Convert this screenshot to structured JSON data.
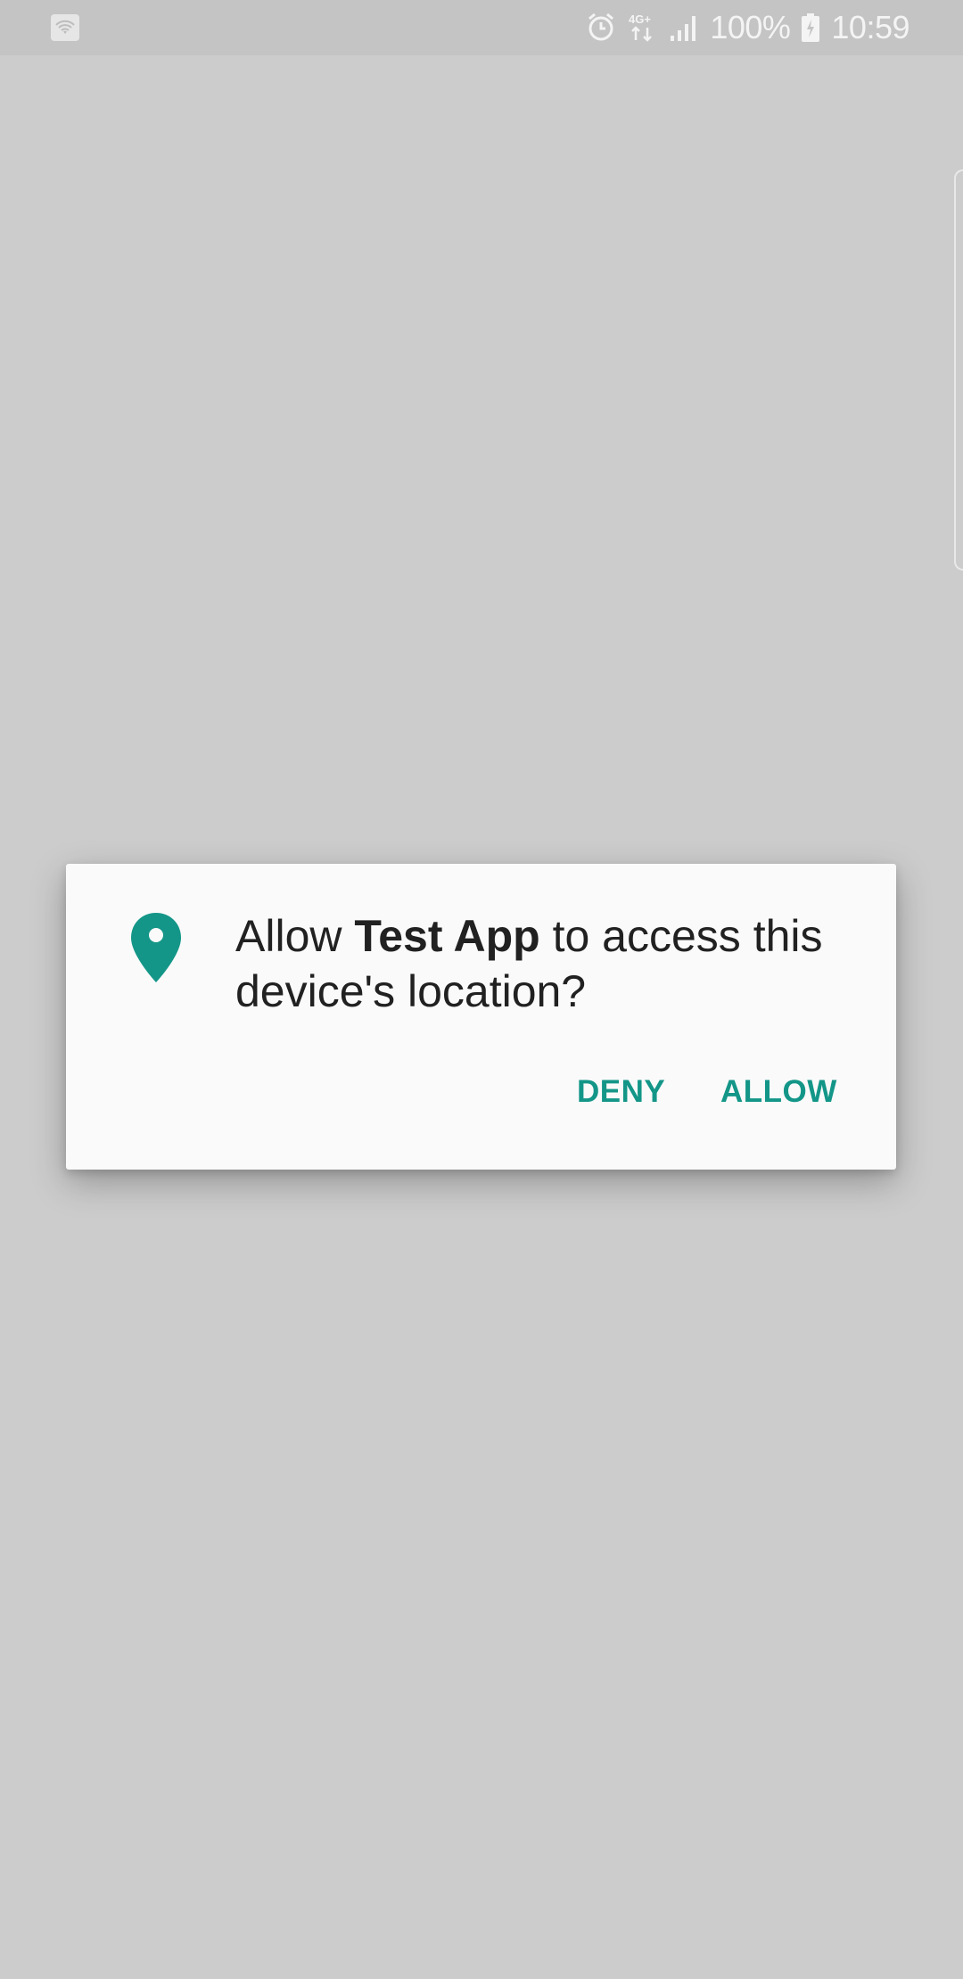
{
  "status_bar": {
    "battery_percent": "100%",
    "time": "10:59",
    "network_type": "4G+",
    "icons": [
      "wifi-app-icon",
      "alarm-icon",
      "network-4g-icon",
      "signal-icon",
      "battery-charging-icon"
    ]
  },
  "dialog": {
    "message_prefix": "Allow ",
    "app_name": "Test App",
    "message_suffix": " to access this device's location?",
    "icon": "location-pin-icon",
    "deny_label": "DENY",
    "allow_label": "ALLOW",
    "accent_color": "#139688"
  },
  "colors": {
    "background": "#cccccc",
    "status_bar": "#c4c4c4",
    "dialog": "#fafafa"
  }
}
